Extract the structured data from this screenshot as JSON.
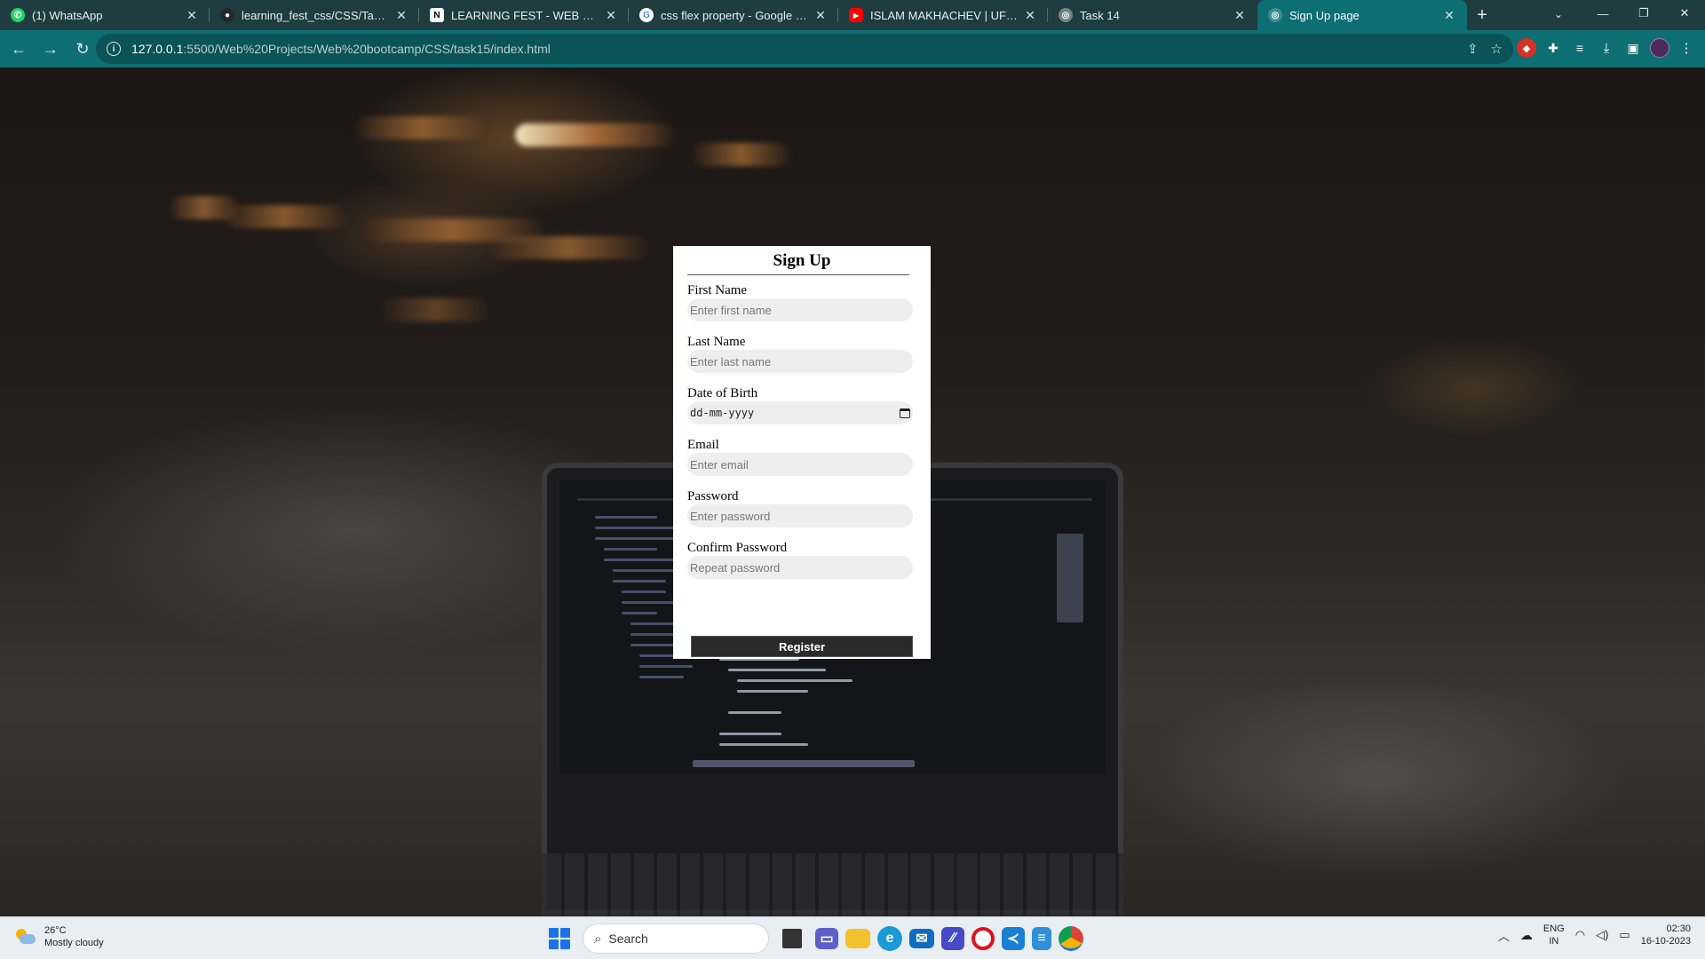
{
  "browser": {
    "tabs": [
      {
        "title": "(1) WhatsApp",
        "icon": "whatsapp-icon",
        "color": "#25d366",
        "active": false
      },
      {
        "title": "learning_fest_css/CSS/Task15 at",
        "icon": "github-icon",
        "color": "#24292f",
        "active": false
      },
      {
        "title": "LEARNING FEST - WEB DEVELO",
        "icon": "notion-icon",
        "color": "#ffffff",
        "active": false
      },
      {
        "title": "css flex property - Google Searc",
        "icon": "google-icon",
        "color": "#ffffff",
        "active": false
      },
      {
        "title": "ISLAM MAKHACHEV | UFC 294",
        "icon": "youtube-icon",
        "color": "#ff0000",
        "active": false
      },
      {
        "title": "Task 14",
        "icon": "globe-icon",
        "color": "#9fb0b2",
        "active": false
      },
      {
        "title": "Sign Up page",
        "icon": "globe-icon",
        "color": "#9fb0b2",
        "active": true
      }
    ],
    "url_host": "127.0.0.1",
    "url_path": ":5500/Web%20Projects/Web%20bootcamp/CSS/task15/index.html"
  },
  "form": {
    "title": "Sign Up",
    "fields": [
      {
        "label": "First Name",
        "placeholder": "Enter first name"
      },
      {
        "label": "Last Name",
        "placeholder": "Enter last name"
      },
      {
        "label": "Date of Birth",
        "value": "dd-mm-yyyy"
      },
      {
        "label": "Email",
        "placeholder": "Enter email"
      },
      {
        "label": "Password",
        "placeholder": "Enter password"
      },
      {
        "label": "Confirm Password",
        "placeholder": "Repeat password"
      }
    ],
    "submit_label": "Register"
  },
  "taskbar": {
    "weather_temp": "26°C",
    "weather_desc": "Mostly cloudy",
    "search_label": "Search",
    "lang_line1": "ENG",
    "lang_line2": "IN",
    "time": "02:30",
    "date": "16-10-2023"
  }
}
